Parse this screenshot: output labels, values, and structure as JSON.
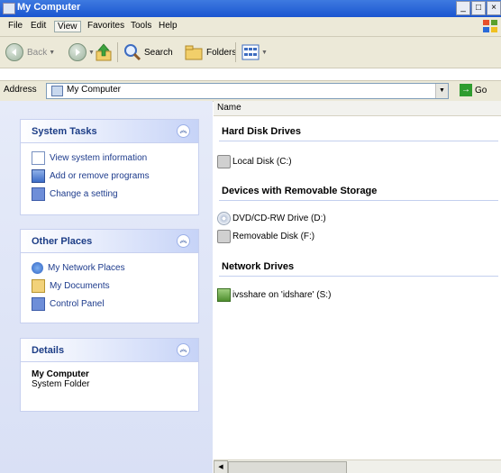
{
  "window": {
    "title": "My Computer",
    "controls": [
      "_",
      "□",
      "×"
    ]
  },
  "menu": [
    "File",
    "Edit",
    "View",
    "Favorites",
    "Tools",
    "Help"
  ],
  "toolbar": {
    "back": "Back",
    "search": "Search",
    "folders": "Folders"
  },
  "address": {
    "label": "Address",
    "value": "My Computer",
    "go": "Go"
  },
  "left": {
    "system_tasks": {
      "title": "System Tasks",
      "items": [
        "View system information",
        "Add or remove programs",
        "Change a setting"
      ]
    },
    "other_places": {
      "title": "Other Places",
      "items": [
        "My Network Places",
        "My Documents",
        "Control Panel"
      ]
    },
    "details": {
      "title": "Details",
      "name": "My Computer",
      "type": "System Folder"
    }
  },
  "right": {
    "column_name": "Name",
    "groups": [
      {
        "title": "Hard Disk Drives",
        "items": [
          "Local Disk (C:)"
        ]
      },
      {
        "title": "Devices with Removable Storage",
        "items": [
          "DVD/CD-RW Drive (D:)",
          "Removable Disk (F:)"
        ]
      },
      {
        "title": "Network Drives",
        "items": [
          "ivsshare on 'idshare' (S:)"
        ]
      }
    ]
  },
  "icons": {
    "back": "back-arrow-icon",
    "forward": "forward-arrow-icon",
    "up": "up-folder-icon",
    "search": "search-icon",
    "folders": "folders-icon",
    "views": "views-icon"
  }
}
